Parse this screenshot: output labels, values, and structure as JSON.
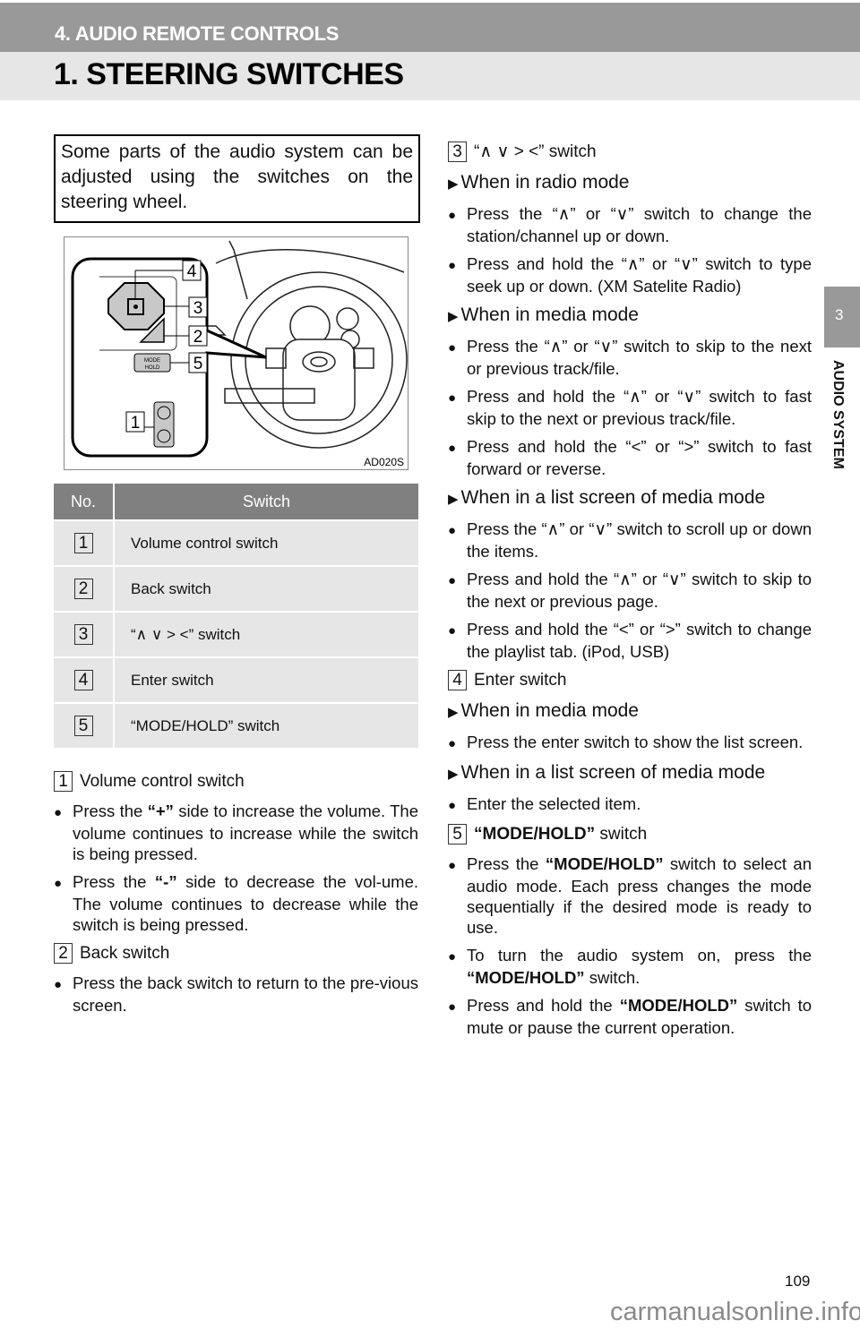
{
  "header": {
    "section": "4. AUDIO REMOTE CONTROLS",
    "title": "1. STEERING SWITCHES"
  },
  "side_tab": {
    "number": "3",
    "label": "AUDIO SYSTEM"
  },
  "intro": "Some parts of the audio system can be adjusted using the switches on the steering wheel.",
  "figure": {
    "code": "AD020S",
    "callouts": [
      "4",
      "3",
      "2",
      "5",
      "1"
    ],
    "mode_label": "MODE",
    "hold_label": "HOLD"
  },
  "table": {
    "headers": [
      "No.",
      "Switch"
    ],
    "rows": [
      {
        "no": "1",
        "switch": "Volume control switch"
      },
      {
        "no": "2",
        "switch": "Back switch"
      },
      {
        "no": "3",
        "switch": "“∧  ∨  >  <” switch"
      },
      {
        "no": "4",
        "switch": "Enter switch"
      },
      {
        "no": "5",
        "switch": "“MODE/HOLD” switch"
      }
    ]
  },
  "left_column": [
    {
      "type": "head",
      "num": "1",
      "segments": [
        {
          "t": "Volume control switch"
        }
      ]
    },
    {
      "type": "bullet",
      "segments": [
        {
          "t": "Press the "
        },
        {
          "t": "“+”",
          "b": true
        },
        {
          "t": " side to increase the volume. The volume continues to increase while the switch is being pressed."
        }
      ]
    },
    {
      "type": "bullet",
      "segments": [
        {
          "t": "Press the "
        },
        {
          "t": "“-”",
          "b": true
        },
        {
          "t": " side to decrease the vol-ume. The volume continues to decrease while the switch is being pressed."
        }
      ]
    },
    {
      "type": "head",
      "num": "2",
      "segments": [
        {
          "t": "Back switch"
        }
      ]
    },
    {
      "type": "bullet",
      "segments": [
        {
          "t": "Press the back switch to return to the pre-vious screen."
        }
      ]
    }
  ],
  "right_column": [
    {
      "type": "head",
      "num": "3",
      "segments": [
        {
          "t": "“∧  ∨  >  <” switch"
        }
      ]
    },
    {
      "type": "mode",
      "text": "When in radio mode"
    },
    {
      "type": "bullet",
      "segments": [
        {
          "t": "Press the “∧” or “∨” switch to change the station/channel up or down."
        }
      ]
    },
    {
      "type": "bullet",
      "segments": [
        {
          "t": "Press and hold the “∧” or “∨” switch to type seek up or down. (XM Satelite Radio)"
        }
      ]
    },
    {
      "type": "mode",
      "text": "When in media mode"
    },
    {
      "type": "bullet",
      "segments": [
        {
          "t": "Press the “∧” or “∨” switch to skip to the next or previous track/file."
        }
      ]
    },
    {
      "type": "bullet",
      "segments": [
        {
          "t": "Press and hold the “∧” or “∨” switch to fast skip to the next or previous track/file."
        }
      ]
    },
    {
      "type": "bullet",
      "segments": [
        {
          "t": "Press and hold the “<” or “>” switch to fast forward or reverse."
        }
      ]
    },
    {
      "type": "mode",
      "text": "When in a list screen of media mode"
    },
    {
      "type": "bullet",
      "segments": [
        {
          "t": "Press the “∧” or “∨” switch to scroll up or down the items."
        }
      ]
    },
    {
      "type": "bullet",
      "segments": [
        {
          "t": "Press and hold the “∧” or “∨” switch to skip to the next or previous page."
        }
      ]
    },
    {
      "type": "bullet",
      "segments": [
        {
          "t": "Press and hold the “<” or “>” switch to change the playlist tab. (iPod, USB)"
        }
      ]
    },
    {
      "type": "head",
      "num": "4",
      "segments": [
        {
          "t": "Enter switch"
        }
      ]
    },
    {
      "type": "mode",
      "text": "When in media mode"
    },
    {
      "type": "bullet",
      "segments": [
        {
          "t": "Press the enter switch to show the list screen."
        }
      ]
    },
    {
      "type": "mode",
      "text": "When in a list screen of media mode"
    },
    {
      "type": "bullet",
      "segments": [
        {
          "t": "Enter the selected item."
        }
      ]
    },
    {
      "type": "head",
      "num": "5",
      "segments": [
        {
          "t": "“MODE/HOLD”",
          "b": true
        },
        {
          "t": " switch"
        }
      ]
    },
    {
      "type": "bullet",
      "segments": [
        {
          "t": "Press the "
        },
        {
          "t": "“MODE/HOLD”",
          "b": true
        },
        {
          "t": " switch to select an audio mode. Each press changes the mode sequentially if the desired mode is ready to use."
        }
      ]
    },
    {
      "type": "bullet",
      "segments": [
        {
          "t": "To turn the audio system on, press the "
        },
        {
          "t": "“MODE/HOLD”",
          "b": true
        },
        {
          "t": " switch."
        }
      ]
    },
    {
      "type": "bullet",
      "segments": [
        {
          "t": "Press and hold the "
        },
        {
          "t": "“MODE/HOLD”",
          "b": true
        },
        {
          "t": " switch to mute or pause the current operation."
        }
      ]
    }
  ],
  "footer": {
    "page_number": "109",
    "watermark": "carmanualsonline.info"
  }
}
